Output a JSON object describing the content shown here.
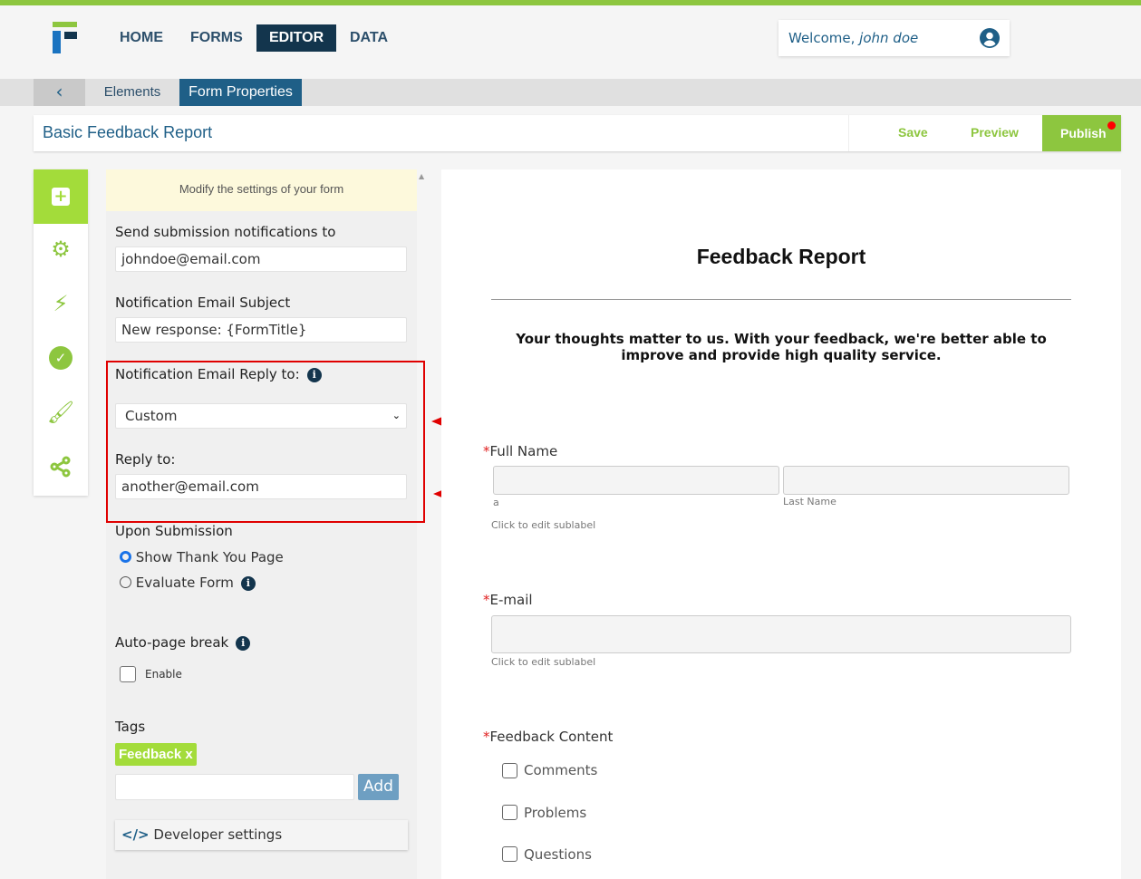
{
  "colors": {
    "accent": "#8dc63f",
    "navy": "#13354d",
    "blue": "#1f5f87",
    "highlight": "#e00000"
  },
  "nav": {
    "items": [
      "HOME",
      "FORMS",
      "EDITOR",
      "DATA"
    ],
    "active": "EDITOR"
  },
  "user": {
    "welcome": "Welcome,",
    "name": "john doe"
  },
  "subnav": {
    "back_icon": "chevron-left-icon",
    "tabs": [
      "Elements",
      "Form Properties"
    ],
    "active": "Form Properties"
  },
  "titlebar": {
    "form_name": "Basic Feedback Report",
    "save": "Save",
    "preview": "Preview",
    "publish": "Publish"
  },
  "rail": {
    "icons": [
      "add-icon",
      "gears-icon",
      "bolt-icon",
      "check-circle-icon",
      "brush-icon",
      "share-icon"
    ]
  },
  "panel": {
    "notice": "Modify the settings of your form",
    "notify_label": "Send submission notifications to",
    "notify_value": "johndoe@email.com",
    "subject_label": "Notification Email Subject",
    "subject_value": "New response: {FormTitle}",
    "reply_label": "Notification Email Reply to:",
    "reply_select": "Custom",
    "reply_to_label": "Reply to:",
    "reply_to_value": "another@email.com",
    "submission_label": "Upon Submission",
    "options": [
      "Show Thank You Page",
      "Evaluate Form"
    ],
    "selected_option": "Show Thank You Page",
    "autobreak_label": "Auto-page break",
    "enable_label": "Enable",
    "tags_label": "Tags",
    "tags": [
      "Feedback"
    ],
    "tag_remove": "x",
    "add_button": "Add",
    "tag_input": "",
    "dev_settings": "Developer settings"
  },
  "form": {
    "title": "Feedback Report",
    "description": "Your thoughts matter to us. With your feedback, we're better able to improve and provide high quality service.",
    "required_mark": "*",
    "full_name_label": "Full Name",
    "first_sublabel": "a",
    "last_sublabel": "Last Name",
    "edit_sublabel": "Click to edit sublabel",
    "email_label": "E-mail",
    "email_sublabel": "Click to edit sublabel",
    "feedback_label": "Feedback Content",
    "feedback_options": [
      "Comments",
      "Problems",
      "Questions"
    ]
  }
}
